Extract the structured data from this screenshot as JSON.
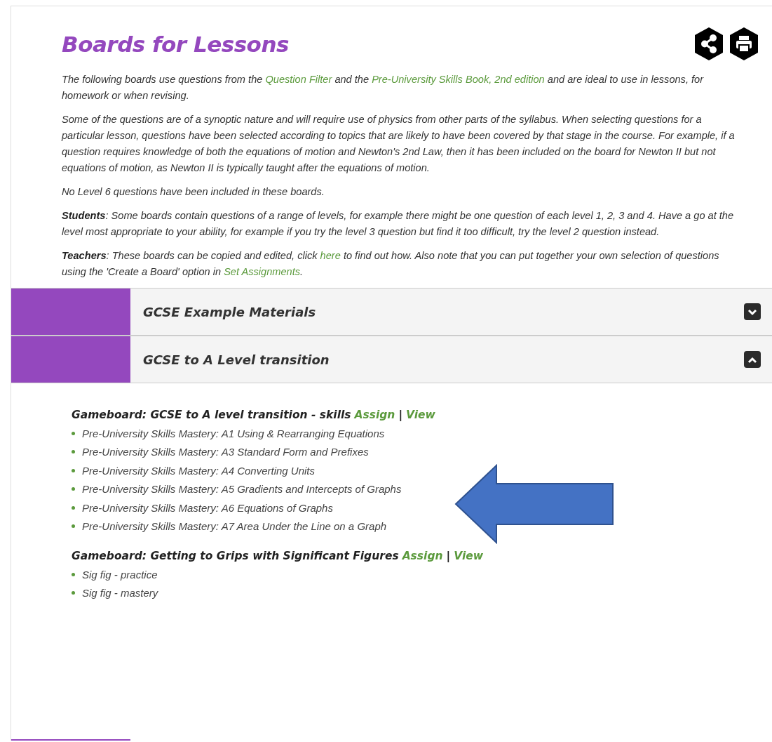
{
  "title": "Boards for Lessons",
  "paragraphs": [
    [
      {
        "kind": "text",
        "text": "The following boards use questions from the "
      },
      {
        "kind": "link",
        "text": "Question Filter"
      },
      {
        "kind": "text",
        "text": " and the "
      },
      {
        "kind": "link",
        "text": "Pre-University Skills Book, 2nd edition"
      },
      {
        "kind": "text",
        "text": " and are ideal to use in lessons, for homework or when revising."
      }
    ],
    [
      {
        "kind": "text",
        "text": "Some of the questions are of a synoptic nature and will require use of physics from other parts of the syllabus. When selecting questions for a particular lesson, questions have been selected according to topics that are likely to have been covered by that stage in the course. For example, if a question requires knowledge of both the equations of motion and Newton's 2nd Law, then it has been included on the board for Newton II but not equations of motion, as Newton II is typically taught after the equations of motion."
      }
    ],
    [
      {
        "kind": "text",
        "text": "No Level 6 questions have been included in these boards."
      }
    ],
    [
      {
        "kind": "strong",
        "text": "Students"
      },
      {
        "kind": "text",
        "text": ": Some boards contain questions of a range of levels, for example there might be one question of each level 1, 2, 3 and 4. Have a go at the level most appropriate to your ability, for example if you try the level 3 question but find it too difficult, try the level 2 question instead."
      }
    ],
    [
      {
        "kind": "strong",
        "text": "Teachers"
      },
      {
        "kind": "text",
        "text": ": These boards can be copied and edited, click "
      },
      {
        "kind": "link",
        "text": "here"
      },
      {
        "kind": "text",
        "text": " to find out how. Also note that you can put together your own selection of questions using the 'Create a Board' option in "
      },
      {
        "kind": "link",
        "text": "Set Assignments"
      },
      {
        "kind": "text",
        "text": "."
      }
    ]
  ],
  "sections": [
    {
      "title": "GCSE Example Materials",
      "expanded": false
    },
    {
      "title": "GCSE to A Level transition",
      "expanded": true,
      "gameboards": [
        {
          "title": "Gameboard: GCSE to A level transition - skills",
          "assign": "Assign",
          "separator": "|",
          "view": "View",
          "items": [
            "Pre-University Skills Mastery: A1 Using & Rearranging Equations",
            "Pre-University Skills Mastery: A3 Standard Form and Prefixes",
            "Pre-University Skills Mastery: A4 Converting Units",
            "Pre-University Skills Mastery: A5 Gradients and Intercepts of Graphs",
            "Pre-University Skills Mastery: A6 Equations of Graphs",
            "Pre-University Skills Mastery: A7 Area Under the Line on a Graph"
          ]
        },
        {
          "title": "Gameboard: Getting to Grips with Significant Figures",
          "assign": "Assign",
          "separator": "|",
          "view": "View",
          "items": [
            "Sig fig - practice",
            "Sig fig - mastery"
          ]
        }
      ]
    }
  ]
}
